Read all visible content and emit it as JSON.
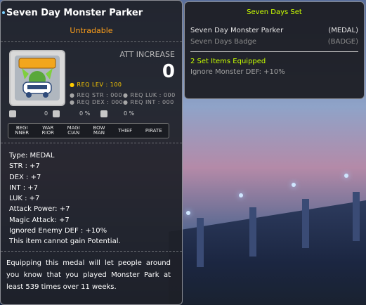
{
  "item": {
    "title": "Seven Day Monster Parker",
    "trade": "Untradable",
    "att_label": "ATT INCREASE",
    "att_value": "0",
    "req_lev": "● REQ LEV : 100",
    "req_str": "● REQ STR : 000",
    "req_luk": "● REQ LUK : 000",
    "req_dex": "● REQ DEX : 000",
    "req_int": "● REQ INT : 000",
    "small": [
      "0",
      "0 %",
      "0 %"
    ],
    "jobs": [
      "BEGI\nNNER",
      "WAR\nRIOR",
      "MAGI\nCIAN",
      "BOW\nMAN",
      "THIEF",
      "PIRATE"
    ],
    "stats": [
      "Type: MEDAL",
      "STR : +7",
      "DEX : +7",
      "INT : +7",
      "LUK : +7",
      "Attack Power: +7",
      "Magic Attack: +7",
      "Ignored Enemy DEF : +10%",
      "This item cannot gain Potential."
    ],
    "description": "Equipping this medal will let people around you know that you played Monster Park at least 539 times over 11 weeks."
  },
  "set": {
    "title": "Seven Days Set",
    "items": [
      {
        "name": "Seven Day Monster Parker",
        "type": "(MEDAL)",
        "color": "#e6e6e6"
      },
      {
        "name": "Seven Days Badge",
        "type": "(BADGE)",
        "color": "#8c8c8c"
      }
    ],
    "equipped": "2 Set Items Equipped",
    "bonus": "Ignore Monster DEF: +10%"
  }
}
